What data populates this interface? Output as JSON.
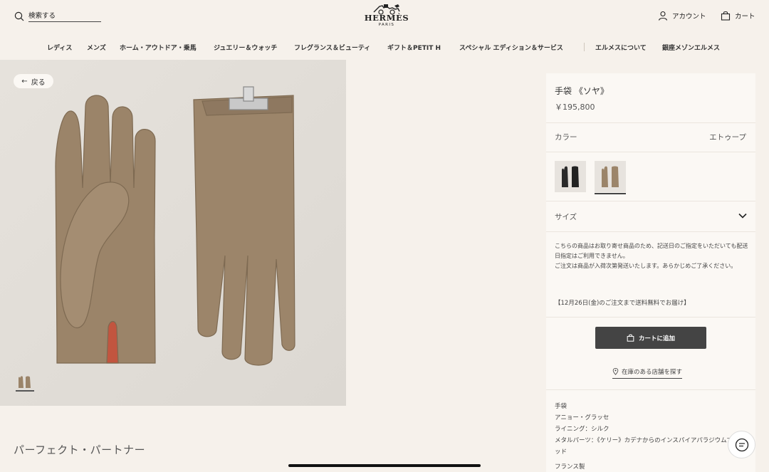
{
  "header": {
    "search_placeholder": "検索する",
    "logo_word": "HERMÈS",
    "logo_sub": "PARIS",
    "account_label": "アカウント",
    "cart_label": "カート"
  },
  "nav": {
    "items": [
      "レディス",
      "メンズ",
      "ホーム・アウトドア・乗馬",
      "ジュエリー＆ウォッチ",
      "フレグランス＆ビューティ",
      "ギフト＆PETIT H",
      "スペシャル エディション＆サービス",
      "エルメスについて",
      "銀座メゾンエルメス"
    ]
  },
  "gallery": {
    "back_label": "戻る",
    "section_title": "パーフェクト・パートナー"
  },
  "product": {
    "title": "手袋 《ソヤ》",
    "price": "￥195,800",
    "color_label": "カラー",
    "color_value": "エトゥープ",
    "swatches": [
      "black",
      "etoupe"
    ],
    "selected_swatch": "etoupe",
    "size_label": "サイズ",
    "notice_line1": "こちらの商品はお取り寄せ商品のため、記送日のご指定をいただいても配送日指定はご利用できません。",
    "notice_line2": "ご注文は商品が入荷次第発送いたします。あらかじめご了承ください。",
    "shipping_note": "【12月26日(金)のご注文まで送料無料でお届け】",
    "add_to_cart_label": "カートに追加",
    "store_link_label": "在庫のある店舗を探す",
    "details": {
      "line1": "手袋",
      "line2": "アニョー・グラッセ",
      "line3": "ライニング：シルク",
      "line4": "メタルパーツ：《ケリー》カデナからのインスパイアパラジウムプレーテッド"
    },
    "made_in": "フランス製"
  },
  "colors": {
    "background": "#f6f1eb",
    "panel": "#fbf8f4",
    "button": "#444444",
    "glove": "#9b8469"
  }
}
